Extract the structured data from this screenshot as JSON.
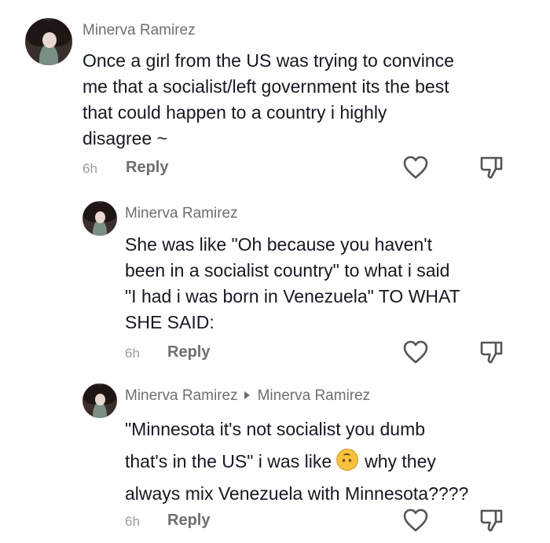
{
  "comments": [
    {
      "username": "Minerva Ramirez",
      "lines": [
        "Once a girl from the US was trying to convince",
        "me that a socialist/left government its the best",
        "that could happen to a country i highly",
        "disagree ~"
      ],
      "time": "6h",
      "reply_label": "Reply"
    },
    {
      "username": "Minerva Ramirez",
      "lines": [
        "She was like \"Oh because you haven't",
        "been in a socialist country\" to what i said",
        "\"I had i was born in Venezuela\" TO WHAT",
        "SHE SAID:"
      ],
      "time": "6h",
      "reply_label": "Reply"
    },
    {
      "username": "Minerva Ramirez",
      "reply_to": "Minerva Ramirez",
      "lines": [
        "\"Minnesota it's not socialist you dumb",
        "that's in the US\" i was like",
        "why they",
        "always mix Venezuela with Minnesota????"
      ],
      "emoji": "upside-down-face-emoji",
      "time": "6h",
      "reply_label": "Reply"
    }
  ],
  "icons": {
    "like": "heart-outline-icon",
    "dislike": "thumbs-down-outline-icon"
  },
  "colors": {
    "text": "#161823",
    "username": "#6e6e73",
    "time": "#9a9a9e",
    "icon": "#555555"
  }
}
